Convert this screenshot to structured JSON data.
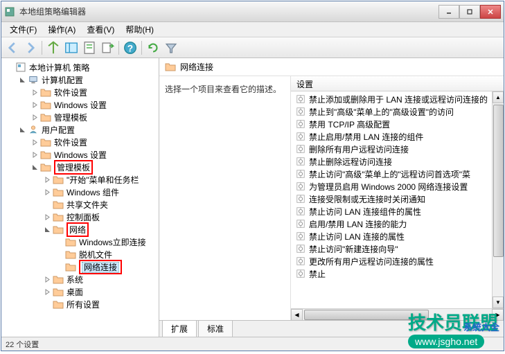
{
  "window": {
    "title": "本地组策略编辑器"
  },
  "menu": {
    "file": "文件(F)",
    "action": "操作(A)",
    "view": "查看(V)",
    "help": "帮助(H)"
  },
  "tree": {
    "root": "本地计算机 策略",
    "computer": "计算机配置",
    "c_software": "软件设置",
    "c_windows": "Windows 设置",
    "c_templates": "管理模板",
    "user": "用户配置",
    "u_software": "软件设置",
    "u_windows": "Windows 设置",
    "u_templates": "管理模板",
    "start_taskbar": "\"开始\"菜单和任务栏",
    "win_components": "Windows 组件",
    "shared_folders": "共享文件夹",
    "control_panel": "控制面板",
    "network": "网络",
    "win_instant": "Windows立即连接",
    "offline_files": "脱机文件",
    "net_connections": "网络连接",
    "system": "系统",
    "desktop": "桌面",
    "all_settings": "所有设置"
  },
  "detail": {
    "title": "网络连接",
    "desc": "选择一个项目来查看它的描述。",
    "col_header": "设置"
  },
  "settings": [
    "禁止添加或删除用于 LAN 连接或远程访问连接的",
    "禁止到\"高级\"菜单上的\"高级设置\"的访问",
    "禁用 TCP/IP 高级配置",
    "禁止启用/禁用 LAN 连接的组件",
    "删除所有用户远程访问连接",
    "禁止删除远程访问连接",
    "禁止访问\"高级\"菜单上的\"远程访问首选项\"菜",
    "为管理员启用 Windows 2000 网络连接设置",
    "连接受限制或无连接时关闭通知",
    "禁止访问 LAN 连接组件的属性",
    "启用/禁用 LAN 连接的能力",
    "禁止访问 LAN 连接的属性",
    "禁止访问\"新建连接向导\"",
    "更改所有用户远程访问连接的属性",
    "禁止"
  ],
  "tabs": {
    "extended": "扩展",
    "standard": "标准"
  },
  "status": "22 个设置",
  "watermark": {
    "text": "技术员联盟",
    "url": "www.jsgho.net",
    "side": "系统大全"
  }
}
